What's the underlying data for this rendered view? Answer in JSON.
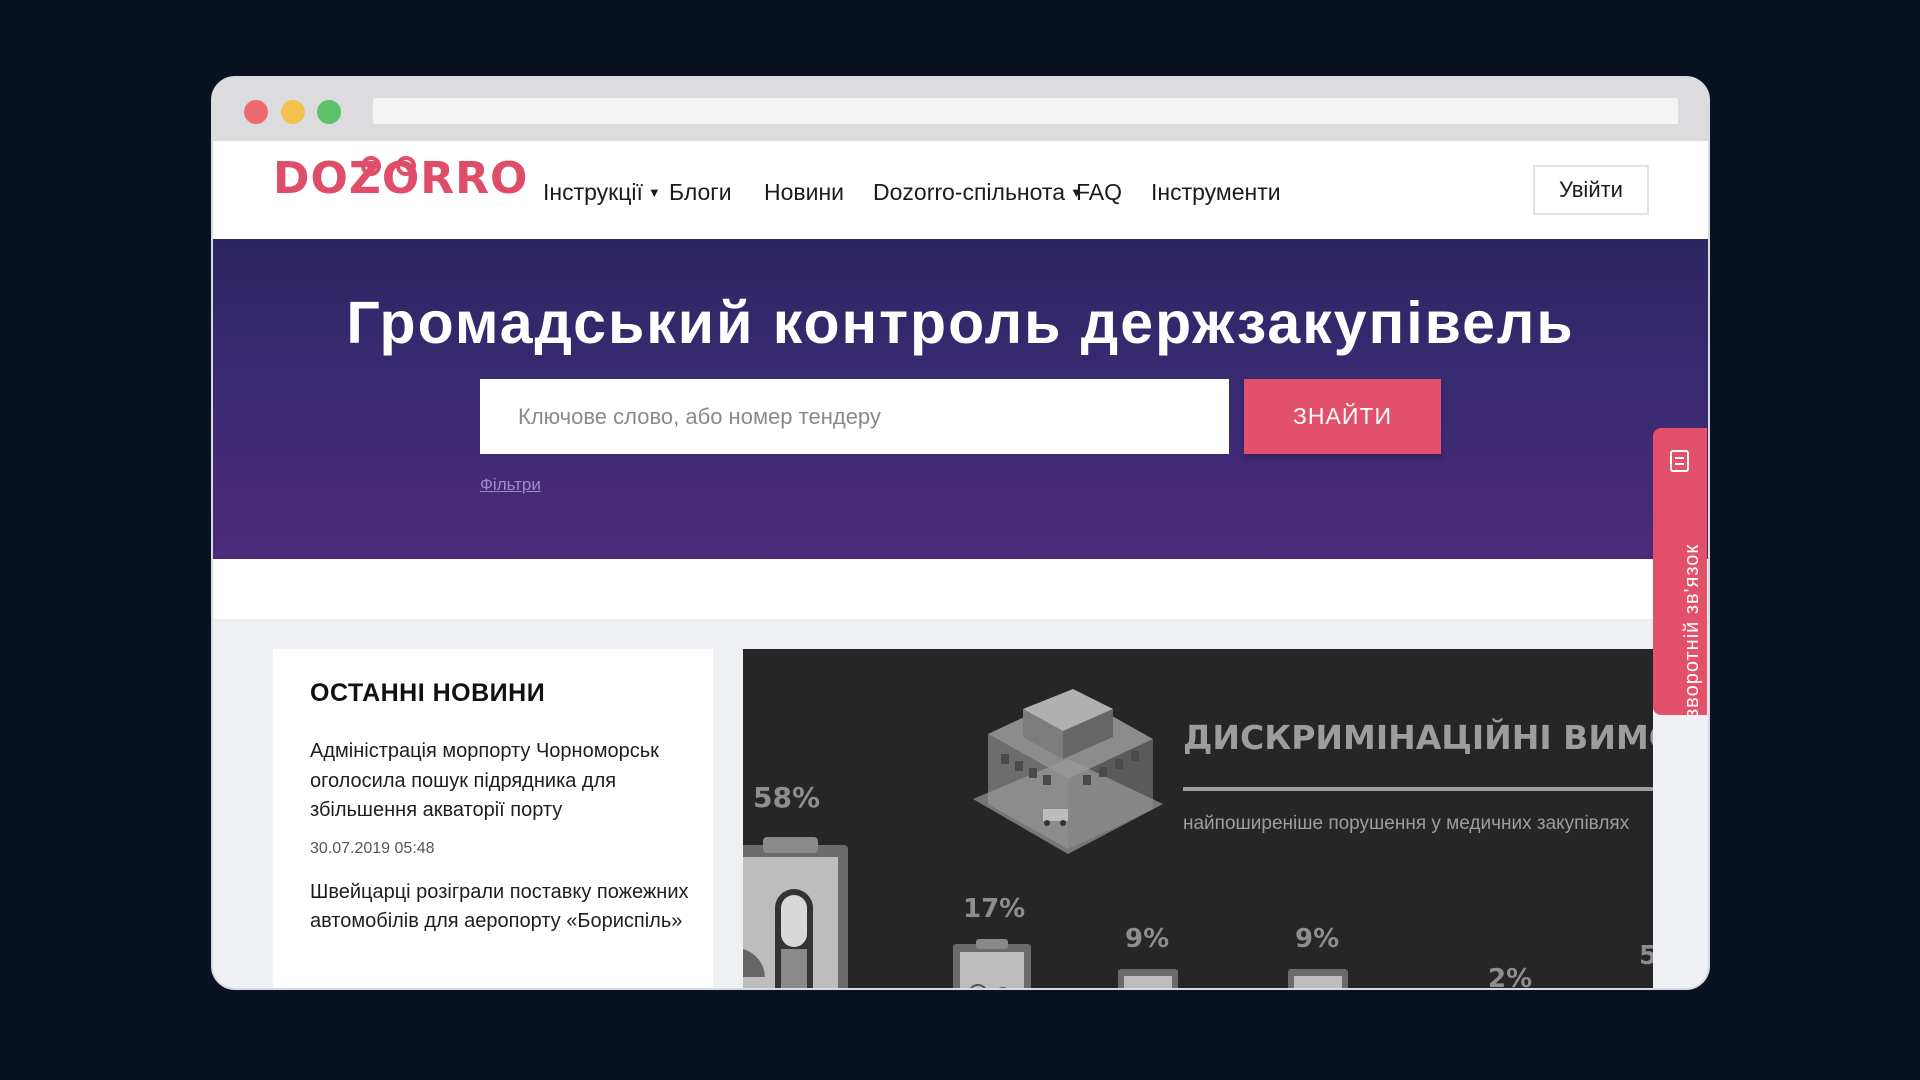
{
  "site": {
    "logo": "DOZORRO"
  },
  "nav": {
    "items": [
      {
        "label": "Інструкції",
        "dropdown": true
      },
      {
        "label": "Блоги",
        "dropdown": false
      },
      {
        "label": "Новини",
        "dropdown": false
      },
      {
        "label": "Dozorro-спільнота",
        "dropdown": true
      },
      {
        "label": "FAQ",
        "dropdown": false
      },
      {
        "label": "Інструменти",
        "dropdown": false
      }
    ],
    "login_label": "Увійти"
  },
  "hero": {
    "title": "Громадський контроль держзакупівель",
    "search_placeholder": "Ключове слово, або номер тендеру",
    "search_button": "ЗНАЙТИ",
    "filters_link": "Фільтри"
  },
  "news": {
    "heading": "ОСТАННІ НОВИНИ",
    "items": [
      {
        "title": "Адміністрація морпорту Чорноморськ оголосила пошук підрядника для збільшення акваторії порту",
        "date": "30.07.2019 05:48"
      },
      {
        "title": "Швейцарці розіграли поставку пожежних автомобілів для аеропорту «Бориспіль»",
        "date": ""
      }
    ]
  },
  "banner": {
    "title": "ДИСКРИМІНАЦІЙНІ ВИМОГИ",
    "subtitle": "найпоширеніше порушення у медичних закупівлях",
    "percents": [
      "58%",
      "17%",
      "9%",
      "9%",
      "2%"
    ]
  },
  "feedback": {
    "label": "зворотній зв'язок"
  },
  "colors": {
    "brand": "#e04d68",
    "hero_top": "#2d2562",
    "hero_bottom": "#4c2a7a",
    "page_bg": "#081220"
  }
}
